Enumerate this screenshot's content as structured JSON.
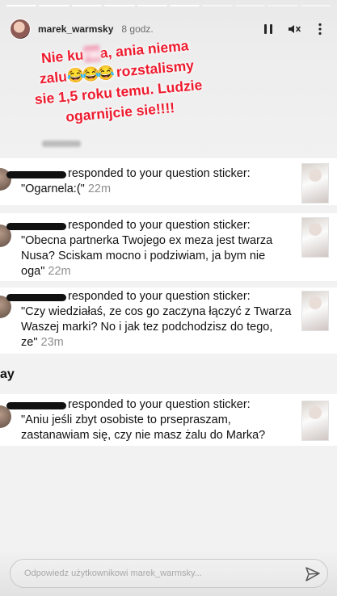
{
  "header": {
    "username": "marek_warmsky",
    "time": "8 godz."
  },
  "note": {
    "part1": "Nie ku",
    "blurred": "rw",
    "part2": "a, ania niema zalu",
    "emoji": "😂😂😂",
    "part3": "rozstalismy sie 1,5 roku temu. Ludzie ogarnijcie sie!!!!"
  },
  "responses": [
    {
      "lead": "responded to your question sticker:",
      "question": "\"Ogarnela:(\"",
      "age": "22m"
    },
    {
      "lead": "responded to your question sticker:",
      "question": "\"Obecna partnerka Twojego ex meza jest twarza Nusa? Sciskam mocno i podziwiam, ja bym nie oga\"",
      "age": "22m"
    },
    {
      "lead": "responded to your question sticker:",
      "question": "\"Czy wiedziałaś, ze cos go zaczyna łączyć z Twarza Waszej marki? No i jak tez podchodzisz do tego, ze\"",
      "age": "23m"
    },
    {
      "lead": "responded to your question sticker:",
      "question": "\"Aniu jeśli zbyt osobiste to prsepraszam, zastanawiam się, czy nie masz żalu do Marka?",
      "age": ""
    }
  ],
  "day_label": "ay",
  "reply": {
    "placeholder": "Odpowiedz użytkownikowi marek_warmsky..."
  },
  "colors": {
    "note_text": "#ee1b2e",
    "background": "#f2f2f2",
    "row_background": "#ffffff"
  }
}
